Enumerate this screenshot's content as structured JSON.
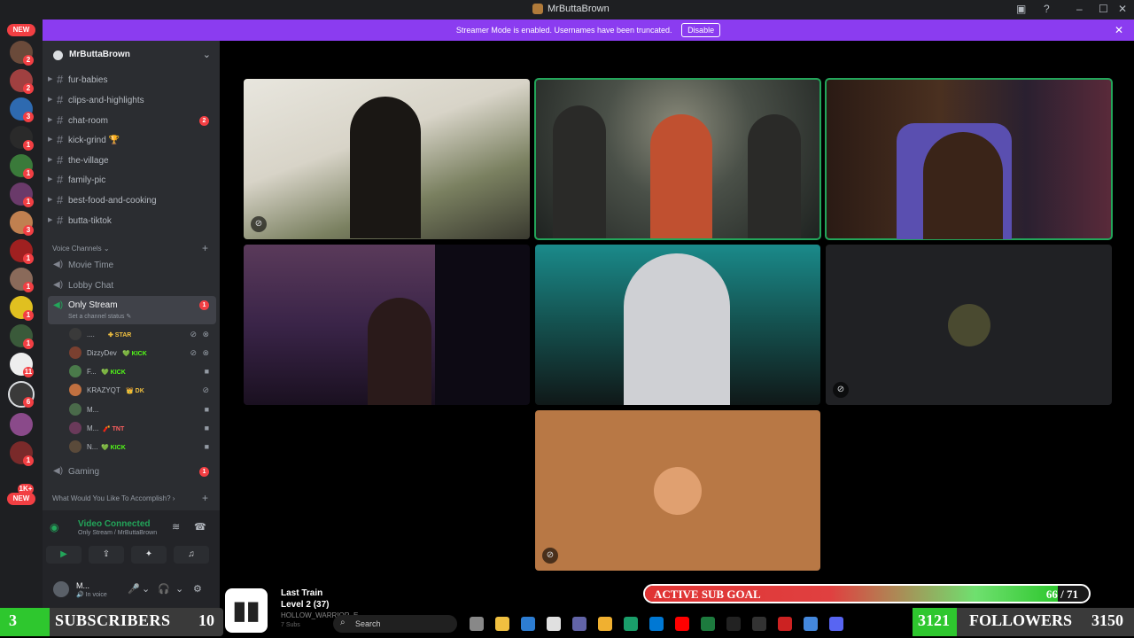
{
  "window": {
    "title": "MrButtaBrown",
    "min_glyph": "–",
    "max_glyph": "☐",
    "close_glyph": "✕",
    "notif_glyph": "▣",
    "help_glyph": "?"
  },
  "banner": {
    "text": "Streamer Mode is enabled. Usernames have been truncated.",
    "disable_label": "Disable",
    "close_glyph": "✕"
  },
  "server_rail": {
    "new_top": "NEW",
    "new_bottom": "NEW",
    "badges": [
      "2",
      "2",
      "3",
      "1",
      "1",
      "1",
      "3",
      "1",
      "1",
      "1",
      "1",
      "1",
      "1",
      "11",
      "6",
      "1",
      "1",
      "1K+"
    ]
  },
  "server": {
    "name": "MrButtaBrown",
    "chevron": "⌄"
  },
  "text_channels": [
    {
      "name": "fur-babies",
      "mention": ""
    },
    {
      "name": "clips-and-highlights",
      "mention": ""
    },
    {
      "name": "chat-room",
      "mention": "2"
    },
    {
      "name": "kick-grind 🏆",
      "mention": ""
    },
    {
      "name": "the-village",
      "mention": ""
    },
    {
      "name": "family-pic",
      "mention": ""
    },
    {
      "name": "best-food-and-cooking",
      "mention": ""
    },
    {
      "name": "butta-tiktok",
      "mention": ""
    }
  ],
  "voice_header": "Voice Channels ⌄",
  "voice_add": "+",
  "voice_channels": {
    "movie_time": "Movie Time",
    "lobby_chat": "Lobby Chat",
    "only_stream": "Only Stream",
    "only_stream_status": "Set a channel status ✎",
    "only_stream_mention": "1",
    "gaming": "Gaming",
    "gaming_mention": "1"
  },
  "voice_users": [
    {
      "name": "....",
      "tag": "✤ STAR",
      "tag_color": "#f0c040",
      "avatar_color": "#3a3a3a"
    },
    {
      "name": "DizzyDev",
      "tag": "💚 KICK",
      "tag_color": "#53fc18",
      "avatar_color": "#7a4030"
    },
    {
      "name": "F...",
      "tag": "💚 KICK",
      "tag_color": "#53fc18",
      "avatar_color": "#4a7a4a"
    },
    {
      "name": "KRAZYQT",
      "tag": "👑 DK",
      "tag_color": "#f0c040",
      "avatar_color": "#c07040"
    },
    {
      "name": "M...",
      "tag": "",
      "tag_color": "#ffffff",
      "avatar_color": "#4a6a4a"
    },
    {
      "name": "M...",
      "tag": "🧨 TNT",
      "tag_color": "#ff6060",
      "avatar_color": "#6a3a5a"
    },
    {
      "name": "N...",
      "tag": "💚 KICK",
      "tag_color": "#53fc18",
      "avatar_color": "#5a4a3a"
    }
  ],
  "accomplish": "What Would You Like To Accomplish? ›",
  "accomplish_add": "+",
  "voice_panel": {
    "status": "Video Connected",
    "location": "Only Stream / MrButtaBrown",
    "signal_glyph": "◉",
    "noise_glyph": "≋",
    "disconnect_glyph": "☎"
  },
  "voice_buttons": {
    "camera": "▶",
    "screen": "⇪",
    "activity": "✦",
    "soundboard": "♫"
  },
  "user": {
    "name": "M...",
    "status": "🔊 In voice",
    "mic": "🎤",
    "headset": "🎧",
    "settings": "⚙",
    "dropdown": "⌄"
  },
  "tile_mute_glyph": "⊘",
  "overlays": {
    "subscribers_current": "3",
    "subscribers_label": "SUBSCRIBERS",
    "subscribers_goal": "10",
    "subscribers_fraction": 0.3,
    "followers_current": "3121",
    "followers_label": "FOLLOWERS",
    "followers_goal": "3150",
    "followers_fraction": 0.99,
    "sub_goal_label": "ACTIVE SUB GOAL",
    "sub_goal_count": "66 / 71",
    "sub_goal_fraction": 0.93
  },
  "last_train": {
    "icon": "▮▮",
    "title": "Last Train",
    "level": "Level 2  (37)",
    "name": "HOLLOW_WARRIOR_E",
    "subs": "7 Subs"
  },
  "taskbar": {
    "search_placeholder": "Search",
    "search_glyph": "⌕",
    "app_colors": [
      "#888888",
      "#f0c040",
      "#2d7dd2",
      "#e0e0e0",
      "#6264a7",
      "#f0b030",
      "#1a9e6a",
      "#0078d4",
      "#ff0000",
      "#1d7a3e",
      "#222222",
      "#333333",
      "#cc2222",
      "#4488dd",
      "#5865f2"
    ]
  },
  "colors": {
    "accent_purple": "#8b3cf0",
    "speaking_green": "#23a55a",
    "mention_red": "#f23f43"
  }
}
